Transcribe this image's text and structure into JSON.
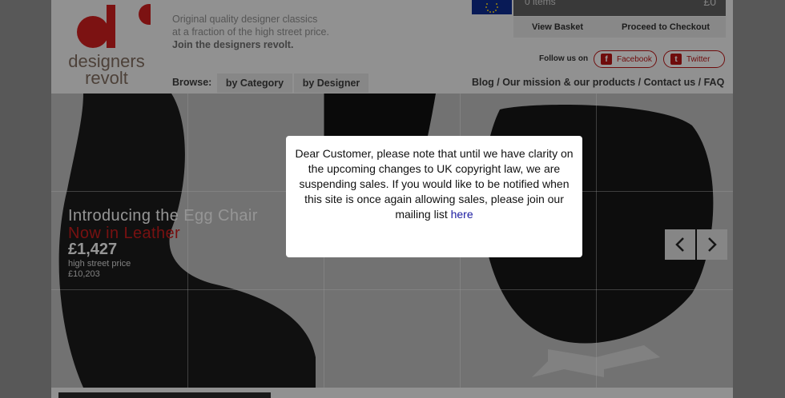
{
  "logo": {
    "line1": "designers",
    "line2": "revolt"
  },
  "tagline": {
    "line1": "Original quality designer classics",
    "line2": "at a fraction of the high street price.",
    "line3": "Join the designers revolt."
  },
  "basket": {
    "items_label": "0 items",
    "total": "£0",
    "view_basket": "View Basket",
    "checkout": "Proceed to Checkout"
  },
  "social": {
    "follow_label": "Follow us on",
    "facebook": "Facebook",
    "twitter": "Twitter",
    "facebook_icon": "f",
    "twitter_icon": "t"
  },
  "browse": {
    "label": "Browse:",
    "tabs": [
      "by Category",
      "by Designer"
    ]
  },
  "toplinks": "Blog / Our mission & our products / Contact us / FAQ",
  "hero": {
    "title": "Introducing the Egg Chair",
    "subtitle": "Now in Leather",
    "price": "£1,427",
    "high_street_label": "high street price",
    "high_street_price": "£10,203",
    "prev_icon": "‹",
    "next_icon": "›"
  },
  "modal": {
    "message": "Dear Customer, please note that until we have clarity on the upcoming changes to UK copyright law, we are suspending sales. If you would like to be notified when this site is once again allowing sales, please join our mailing list",
    "link_text": "here"
  },
  "colors": {
    "brand_red": "#c11c1c",
    "link_blue": "#1a1aa0"
  }
}
